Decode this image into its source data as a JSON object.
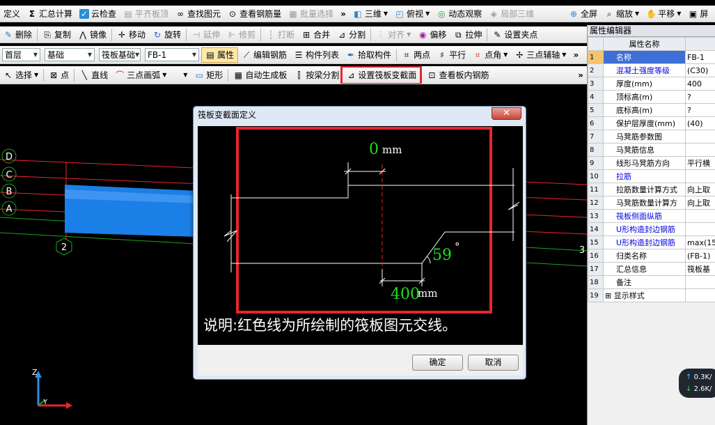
{
  "toolbar1": {
    "items": [
      "定义",
      "汇总计算",
      "云检查",
      "平齐板顶",
      "查找图元",
      "查看钢筋量",
      "批量选择",
      "三维",
      "俯视",
      "动态观察",
      "局部三维",
      "全屏",
      "缩放",
      "平移",
      "屏"
    ]
  },
  "toolbar2": {
    "items": [
      "删除",
      "复制",
      "镜像",
      "移动",
      "旋转",
      "延伸",
      "修剪",
      "打断",
      "合并",
      "分割",
      "对齐",
      "偏移",
      "拉伸",
      "设置夹点"
    ]
  },
  "toolbar3": {
    "floor": "首层",
    "category": "基础",
    "type": "筏板基础",
    "element": "FB-1",
    "items": [
      "属性",
      "编辑钢筋",
      "构件列表",
      "拾取构件",
      "两点",
      "平行",
      "点角",
      "三点辅轴"
    ]
  },
  "toolbar4": {
    "items": [
      "选择",
      "点",
      "直线",
      "三点画弧",
      "矩形",
      "自动生成板",
      "按梁分割",
      "设置筏板变截面",
      "查看板内钢筋"
    ]
  },
  "viewport": {
    "axis_labels": [
      "D",
      "C",
      "B",
      "A"
    ],
    "axis_numbers": [
      "2",
      "3"
    ],
    "z_label": "Z",
    "y_label": "Y"
  },
  "dialog": {
    "title": "筏板变截面定义",
    "close": "✕",
    "top_value": "0",
    "top_unit": "mm",
    "angle_value": "59",
    "angle_unit": "°",
    "bottom_value": "400",
    "bottom_unit": "mm",
    "note": "说明:红色线为所绘制的筏板图元交线。",
    "ok": "确定",
    "cancel": "取消"
  },
  "properties": {
    "title": "属性编辑器",
    "header_name": "属性名称",
    "rows": [
      {
        "n": "1",
        "name": "名称",
        "value": "FB-1",
        "blue": true
      },
      {
        "n": "2",
        "name": "混凝土强度等级",
        "value": "(C30)",
        "blue": true
      },
      {
        "n": "3",
        "name": "厚度(mm)",
        "value": "400",
        "blue": false
      },
      {
        "n": "4",
        "name": "顶标高(m)",
        "value": "?",
        "blue": false
      },
      {
        "n": "5",
        "name": "底标高(m)",
        "value": "?",
        "blue": false
      },
      {
        "n": "6",
        "name": "保护层厚度(mm)",
        "value": "(40)",
        "blue": false
      },
      {
        "n": "7",
        "name": "马凳筋参数图",
        "value": "",
        "blue": false
      },
      {
        "n": "8",
        "name": "马凳筋信息",
        "value": "",
        "blue": false
      },
      {
        "n": "9",
        "name": "线形马凳筋方向",
        "value": "平行横",
        "blue": false
      },
      {
        "n": "10",
        "name": "拉筋",
        "value": "",
        "blue": true
      },
      {
        "n": "11",
        "name": "拉筋数量计算方式",
        "value": "向上取",
        "blue": false
      },
      {
        "n": "12",
        "name": "马凳筋数量计算方",
        "value": "向上取",
        "blue": false
      },
      {
        "n": "13",
        "name": "筏板侧面纵筋",
        "value": "",
        "blue": true
      },
      {
        "n": "14",
        "name": "U形构造封边钢筋",
        "value": "",
        "blue": true
      },
      {
        "n": "15",
        "name": "U形构造封边钢筋",
        "value": "max(15",
        "blue": true
      },
      {
        "n": "16",
        "name": "归类名称",
        "value": "(FB-1)",
        "blue": false
      },
      {
        "n": "17",
        "name": "汇总信息",
        "value": "筏板基",
        "blue": false
      },
      {
        "n": "18",
        "name": "备注",
        "value": "",
        "blue": false
      },
      {
        "n": "19",
        "name": "显示样式",
        "value": "",
        "blue": false
      }
    ]
  },
  "network": {
    "up": "0.3K/",
    "down": "2.6K/"
  },
  "colors": {
    "dim_green": "#22dd22",
    "annotation_red": "#e8262b",
    "slab_blue": "#1a7fe6"
  }
}
